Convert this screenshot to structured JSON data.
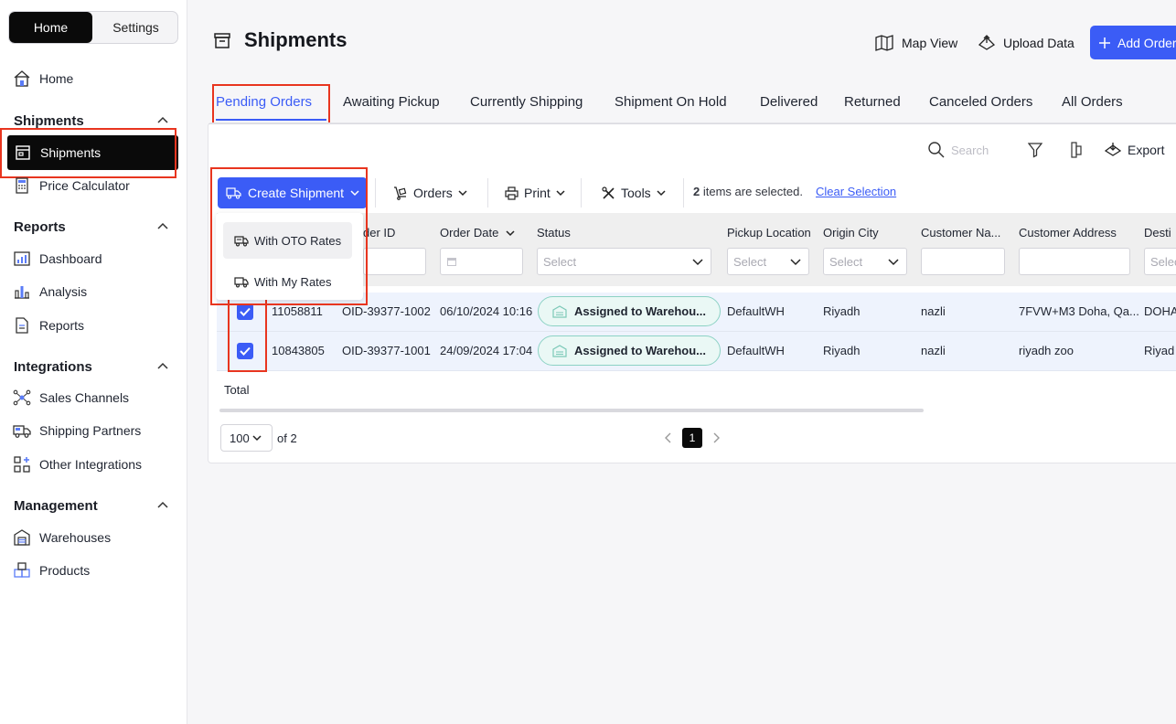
{
  "sidebar": {
    "switch": {
      "home": "Home",
      "settings": "Settings"
    },
    "home": "Home",
    "sections": {
      "shipments": "Shipments",
      "reports": "Reports",
      "integrations": "Integrations",
      "management": "Management"
    },
    "items": {
      "shipments": "Shipments",
      "price_calculator": "Price Calculator",
      "dashboard": "Dashboard",
      "analysis": "Analysis",
      "reports": "Reports",
      "sales_channels": "Sales Channels",
      "shipping_partners": "Shipping Partners",
      "other_integrations": "Other Integrations",
      "warehouses": "Warehouses",
      "products": "Products"
    }
  },
  "header": {
    "title": "Shipments",
    "map_view": "Map View",
    "upload_data": "Upload Data",
    "add_order": "Add Order"
  },
  "tabs": [
    "Pending Orders",
    "Awaiting Pickup",
    "Currently Shipping",
    "Shipment On Hold",
    "Delivered",
    "Returned",
    "Canceled Orders",
    "All Orders"
  ],
  "toolbar": {
    "search_placeholder": "Search",
    "export": "Export",
    "create_shipment": "Create Shipment",
    "orders": "Orders",
    "print": "Print",
    "tools": "Tools",
    "selected_count": "2",
    "selected_suffix": " items are selected.",
    "clear_selection": "Clear Selection"
  },
  "dropdown": {
    "with_oto_rates": "With OTO Rates",
    "with_my_rates": "With My Rates"
  },
  "table": {
    "headers": {
      "order_id": "der ID",
      "order_date": "Order Date",
      "status": "Status",
      "pickup_location": "Pickup Location",
      "origin_city": "Origin City",
      "customer_name": "Customer Na...",
      "customer_address": "Customer Address",
      "destination": "Desti"
    },
    "filters": {
      "status": "Select",
      "pickup": "Select",
      "origin": "Select",
      "destination": "Selec"
    },
    "rows": [
      {
        "id": "11058811",
        "order_id": "OID-39377-1002",
        "date": "06/10/2024 10:16",
        "status": "Assigned to Warehou...",
        "pickup": "DefaultWH",
        "origin": "Riyadh",
        "customer": "nazli",
        "address": "7FVW+M3 Doha, Qa...",
        "destination": "DOHA"
      },
      {
        "id": "10843805",
        "order_id": "OID-39377-1001",
        "date": "24/09/2024 17:04",
        "status": "Assigned to Warehou...",
        "pickup": "DefaultWH",
        "origin": "Riyadh",
        "customer": "nazli",
        "address": "riyadh zoo",
        "destination": "Riyad"
      }
    ],
    "total_label": "Total"
  },
  "pagination": {
    "page_size": "100",
    "of_text": "of 2",
    "current_page": "1"
  },
  "colors": {
    "accent": "#3b5cf6",
    "highlight": "#e8351f",
    "status_pill": "#8cd2c4"
  }
}
